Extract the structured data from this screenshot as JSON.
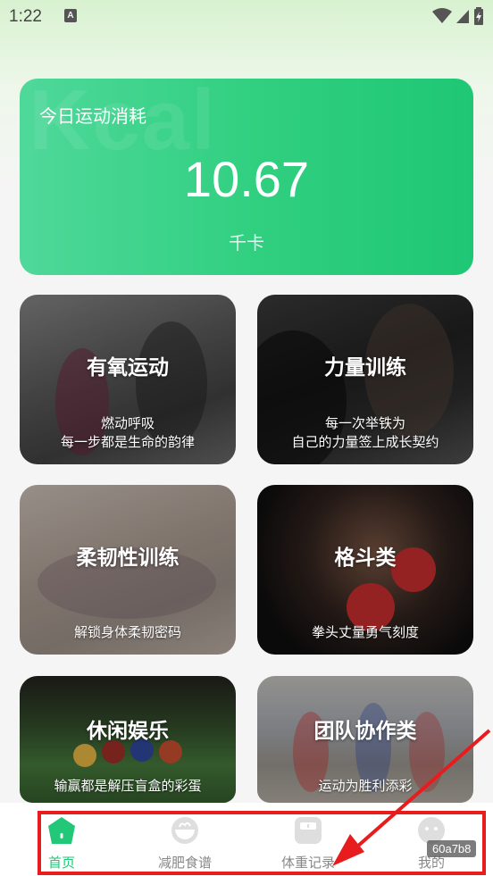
{
  "status_bar": {
    "time": "1:22",
    "notification_glyph": "A"
  },
  "hero": {
    "title": "今日运动消耗",
    "value": "10.67",
    "unit": "千卡",
    "watermark": "Kcal",
    "accent_color": "#2fcf7f"
  },
  "categories": [
    {
      "title": "有氧运动",
      "subtitle_1": "燃动呼吸",
      "subtitle_2": "每一步都是生命的韵律"
    },
    {
      "title": "力量训练",
      "subtitle_1": "每一次举铁为",
      "subtitle_2": "自己的力量签上成长契约"
    },
    {
      "title": "柔韧性训练",
      "subtitle_1": "解锁身体柔韧密码"
    },
    {
      "title": "格斗类",
      "subtitle_1": "拳头丈量勇气刻度"
    },
    {
      "title": "休闲娱乐",
      "subtitle_1": "输赢都是解压盲盒的彩蛋"
    },
    {
      "title": "团队协作类",
      "subtitle_1": "运动为胜利添彩"
    }
  ],
  "tabbar": {
    "tabs": [
      {
        "label": "首页",
        "icon": "home-icon",
        "active": true
      },
      {
        "label": "减肥食谱",
        "icon": "bowl-icon",
        "active": false
      },
      {
        "label": "体重记录",
        "icon": "scale-icon",
        "active": false
      },
      {
        "label": "我的",
        "icon": "face-icon",
        "active": false
      }
    ],
    "active_color": "#22c777",
    "inactive_color": "#888888"
  },
  "overlay_tag": "60a7b8"
}
